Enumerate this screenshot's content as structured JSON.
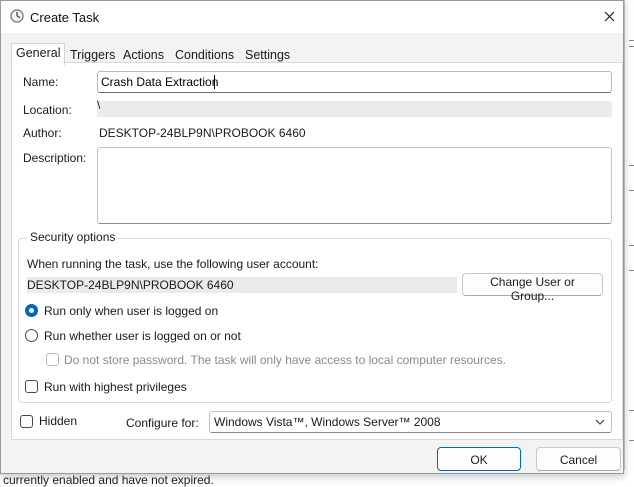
{
  "window": {
    "title": "Create Task",
    "icon": "task-scheduler-clock-icon"
  },
  "tabs": [
    {
      "label": "General",
      "active": true
    },
    {
      "label": "Triggers",
      "active": false
    },
    {
      "label": "Actions",
      "active": false
    },
    {
      "label": "Conditions",
      "active": false
    },
    {
      "label": "Settings",
      "active": false
    }
  ],
  "general": {
    "name_label": "Name:",
    "name_value": "Crash Data Extraction",
    "location_label": "Location:",
    "location_value": "\\",
    "author_label": "Author:",
    "author_value": "DESKTOP-24BLP9N\\PROBOOK 6460",
    "description_label": "Description:",
    "description_value": ""
  },
  "security": {
    "title": "Security options",
    "account_prompt": "When running the task, use the following user account:",
    "account_value": "DESKTOP-24BLP9N\\PROBOOK 6460",
    "change_user_button": "Change User or Group...",
    "radio_logged_on": {
      "label": "Run only when user is logged on",
      "checked": true
    },
    "radio_logged_on_or_not": {
      "label": "Run whether user is logged on or not",
      "checked": false
    },
    "no_store_password": {
      "label": "Do not store password.  The task will only have access to local computer resources.",
      "checked": false,
      "enabled": false
    },
    "highest_privileges": {
      "label": "Run with highest privileges",
      "checked": false
    }
  },
  "bottom": {
    "hidden_label": "Hidden",
    "hidden_checked": false,
    "configure_label": "Configure for:",
    "configure_value": "Windows Vista™, Windows Server™ 2008"
  },
  "buttons": {
    "ok": "OK",
    "cancel": "Cancel"
  },
  "background": {
    "status_text": "currently enabled and have not expired."
  },
  "colors": {
    "accent": "#0067c0"
  }
}
